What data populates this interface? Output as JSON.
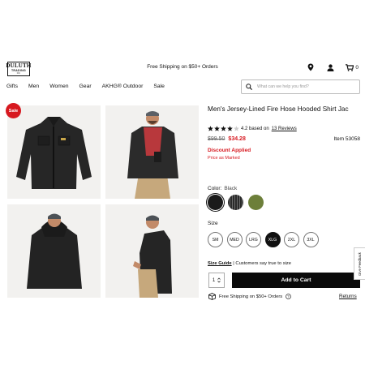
{
  "header": {
    "logo": {
      "line1": "DULUTH",
      "line2": "TRADING",
      "line3": "CO."
    },
    "promo": "Free Shipping on $50+ Orders",
    "icons": [
      "location-pin-icon",
      "user-icon",
      "cart-icon"
    ],
    "cart_count": "0"
  },
  "nav": {
    "items": [
      "Gifts",
      "Men",
      "Women",
      "Gear",
      "AKHG® Outdoor",
      "Sale"
    ]
  },
  "search": {
    "placeholder": "What can we help you find?"
  },
  "gallery": {
    "badge": "Sale"
  },
  "product": {
    "title": "Men's Jersey-Lined Fire Hose Hooded Shirt Jac",
    "rating": 4.2,
    "rating_text": "4.2 based on",
    "reviews_link": "13 Reviews",
    "old_price": "$99.50",
    "new_price": "$34.28",
    "item_number": "Item 53058",
    "discount_label": "Discount Applied",
    "price_note": "Price as Marked",
    "color_label": "Color:",
    "color_value": "Black",
    "swatches": [
      {
        "name": "Black",
        "color": "#1b1b1b"
      },
      {
        "name": "Stripe",
        "color": "#3a3a3a"
      },
      {
        "name": "Olive",
        "color": "#6d7f3a"
      }
    ],
    "size_label": "Size",
    "sizes": [
      "SM",
      "MED",
      "LRG",
      "XLG",
      "2XL",
      "3XL"
    ],
    "selected_size": "XLG",
    "size_guide": "Size Guide",
    "size_note": "| Customers say true to size",
    "qty": "1",
    "add_to_cart": "Add to Cart",
    "free_shipping": "Free Shipping on $50+ Orders",
    "returns": "Returns"
  },
  "feedback": "Give Feedback",
  "colors": {
    "accent_red": "#d71920",
    "button_black": "#0a0a0a"
  }
}
